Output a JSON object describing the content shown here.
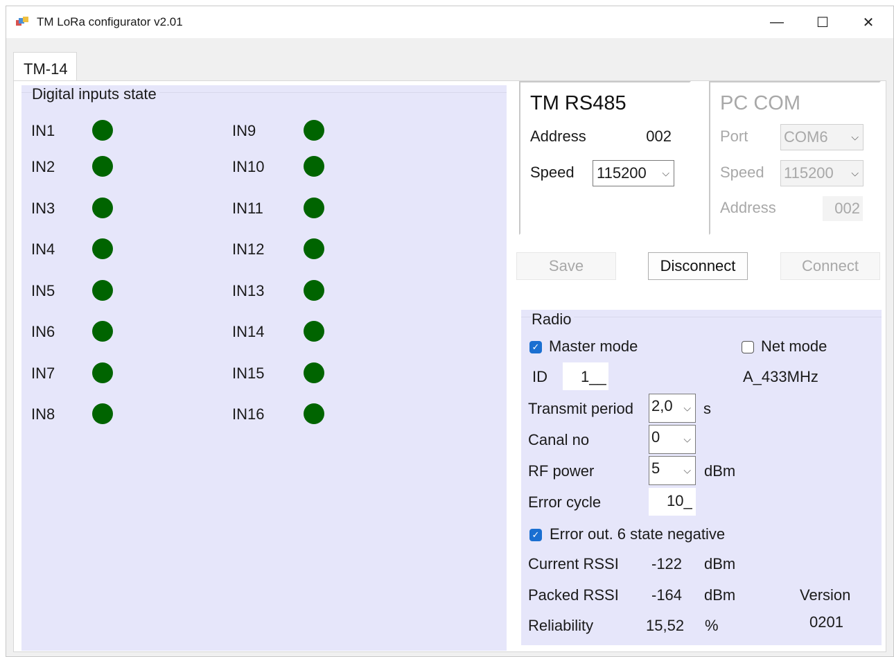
{
  "window": {
    "title": "TM LoRa configurator v2.01"
  },
  "titlebar": {
    "minimize": "—",
    "maximize": "☐",
    "close": "✕"
  },
  "tab": {
    "label": "TM-14"
  },
  "digital_inputs": {
    "title": "Digital inputs state",
    "left": [
      "IN1",
      "IN2",
      "IN3",
      "IN4",
      "IN5",
      "IN6",
      "IN7",
      "IN8"
    ],
    "right": [
      "IN9",
      "IN10",
      "IN11",
      "IN12",
      "IN13",
      "IN14",
      "IN15",
      "IN16"
    ],
    "led_color": "#006400"
  },
  "tm_rs485": {
    "title": "TM RS485",
    "address_label": "Address",
    "address_value": "002",
    "speed_label": "Speed",
    "speed_value": "115200"
  },
  "pc_com": {
    "title": "PC COM",
    "port_label": "Port",
    "port_value": "COM6",
    "speed_label": "Speed",
    "speed_value": "115200",
    "address_label": "Address",
    "address_value": "002"
  },
  "actions": {
    "save": "Save",
    "disconnect": "Disconnect",
    "connect": "Connect"
  },
  "radio": {
    "title": "Radio",
    "master_mode": "Master mode",
    "master_checked": true,
    "net_mode": "Net mode",
    "net_checked": false,
    "id_label": "ID",
    "id_value": "1__",
    "band": "A_433MHz",
    "transmit_label": "Transmit period",
    "transmit_value": "2,0",
    "transmit_unit": "s",
    "canal_label": "Canal no",
    "canal_value": "0",
    "rfpower_label": "RF power",
    "rfpower_value": "5",
    "rfpower_unit": "dBm",
    "errcycle_label": "Error cycle",
    "errcycle_value": "10_",
    "error_out_label": "Error out. 6 state negative",
    "error_out_checked": true,
    "current_rssi_label": "Current RSSI",
    "current_rssi_value": "-122",
    "current_rssi_unit": "dBm",
    "packed_rssi_label": "Packed RSSI",
    "packed_rssi_value": "-164",
    "packed_rssi_unit": "dBm",
    "reliability_label": "Reliability",
    "reliability_value": "15,52",
    "reliability_unit": "%",
    "version_label": "Version",
    "version_value": "0201"
  },
  "colors": {
    "panel": "#e6e6fa",
    "check_accent": "#1a6fd1"
  }
}
